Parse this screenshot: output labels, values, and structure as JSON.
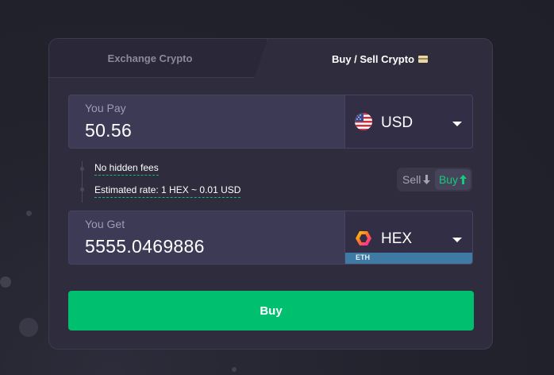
{
  "tabs": {
    "exchange_label": "Exchange Crypto",
    "buy_sell_label": "Buy / Sell Crypto",
    "buy_sell_icon": "credit-card-icon"
  },
  "pay": {
    "label": "You Pay",
    "amount": "50.56",
    "currency": "USD",
    "currency_icon": "us-flag-icon"
  },
  "info": {
    "fees": "No hidden fees",
    "rate": "Estimated rate: 1 HEX ~ 0.01 USD"
  },
  "mode_toggle": {
    "sell_label": "Sell",
    "buy_label": "Buy",
    "active": "Buy"
  },
  "get": {
    "label": "You Get",
    "amount": "5555.0469886",
    "currency": "HEX",
    "currency_icon": "hex-logo-icon",
    "network": "ETH"
  },
  "action": {
    "button_label": "Buy"
  },
  "colors": {
    "accent": "#00bf6f",
    "network_badge": "#3f7aa5",
    "card_bg": "#2e2c3d"
  }
}
